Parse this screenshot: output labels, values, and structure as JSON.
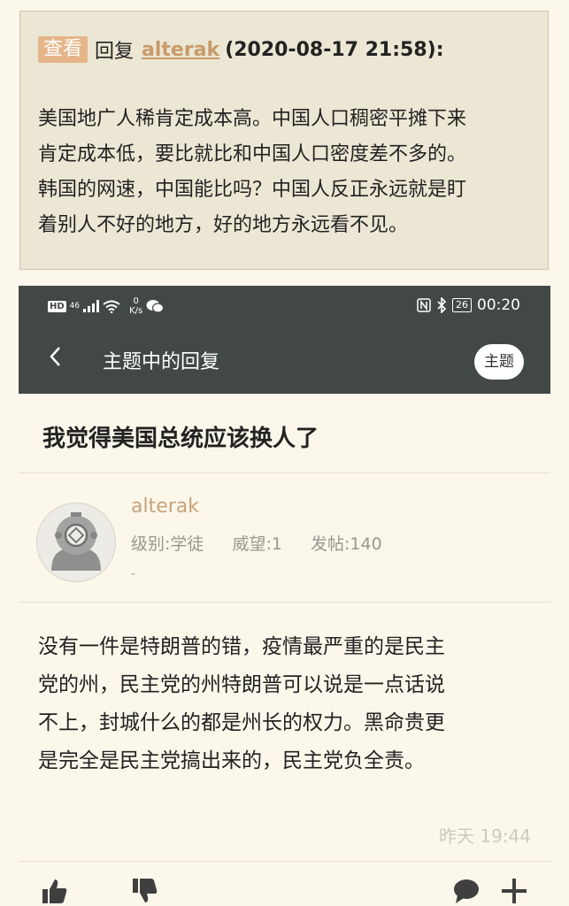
{
  "quote": {
    "view_label": "查看",
    "reply_label": "回复",
    "username": "alterak",
    "timestamp": "(2020-08-17 21:58):",
    "lines": [
      "美国地广人稀肯定成本高。中国人口稠密平摊下来",
      "肯定成本低，要比就比和中国人口密度差不多的。",
      "韩国的网速，中国能比吗？中国人反正永远就是盯",
      "着别人不好的地方，好的地方永远看不见。"
    ]
  },
  "status_bar": {
    "hd": "HD",
    "signal_type": "46",
    "speed_value": "0",
    "speed_unit": "K/s",
    "battery": "26",
    "time": "00:20"
  },
  "nav": {
    "title": "主题中的回复",
    "topic_button": "主题"
  },
  "thread": {
    "title": "我觉得美国总统应该换人了"
  },
  "post": {
    "username": "alterak",
    "level": "级别:学徒",
    "reputation": "威望:1",
    "posts": "发帖:140",
    "signature": "-",
    "lines": [
      "没有一件是特朗普的错，疫情最严重的是民主",
      "党的州，民主党的州特朗普可以说是一点话说",
      "不上，封城什么的都是州长的权力。黑命贵更",
      "是完全是民主党搞出来的，民主党负全责。"
    ],
    "time": "昨天 19:44"
  },
  "icons": {
    "like": "thumbs-up-icon",
    "dislike": "thumbs-down-icon",
    "comment": "comment-icon",
    "add": "plus-icon"
  },
  "colors": {
    "quote_bg": "#ebe7d4",
    "page_bg": "#fbf7ea",
    "header_bg": "#424846",
    "accent": "#c9a27b",
    "view_tag": "#e6b58a"
  }
}
